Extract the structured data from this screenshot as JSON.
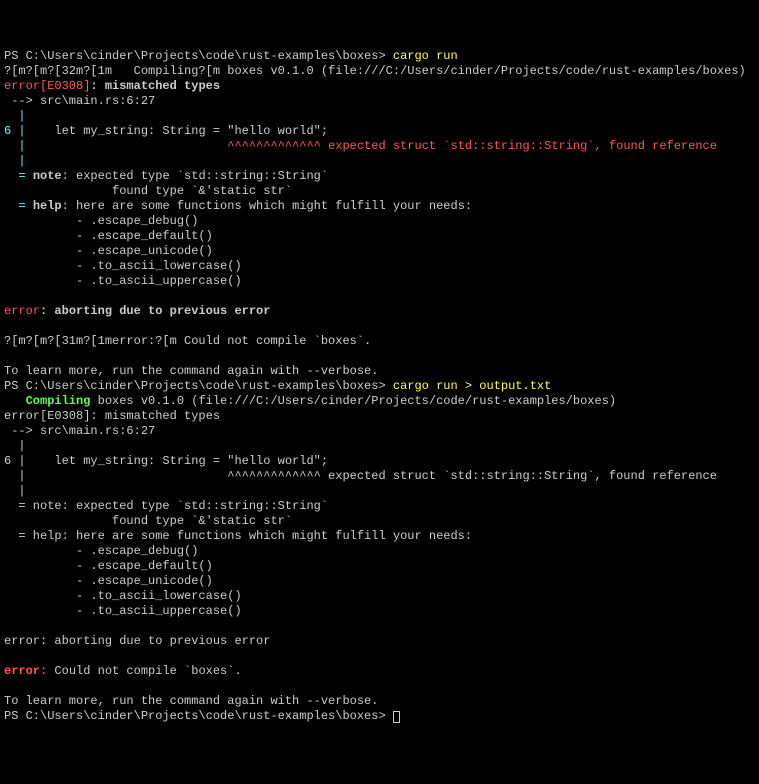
{
  "prompt1_path": "PS C:\\Users\\cinder\\Projects\\code\\rust-examples\\boxes> ",
  "prompt1_cmd": "cargo run",
  "run1_line1_a": "?[m?[m?[32m?[1m   Compiling?[m boxes v0.1.0 (file:///C:/Users/cinder/Projects/code/rust-examples/boxes)",
  "run1_err_a": "error[E0308]",
  "run1_err_b": ": mismatched types",
  "run1_loc": " --> src\\main.rs:6:27",
  "gutter_pipe_only": "  |",
  "gutter_6": "6",
  "gutter_6_pipe": " |",
  "code_line": "    let my_string: String = \"hello world\";",
  "caret_pad": "                            ",
  "caret": "^^^^^^^^^^^^^",
  "caret_msg": " expected struct `std::string::String`, found reference",
  "note_eq": "  = ",
  "note_label": "note",
  "note_text1": ": expected type `std::string::String`",
  "note_text2": "               found type `&'static str`",
  "help_label": "help",
  "help_text": ": here are some functions which might fulfill your needs:",
  "sug1": "          - .escape_debug()",
  "sug2": "          - .escape_default()",
  "sug3": "          - .escape_unicode()",
  "sug4": "          - .to_ascii_lowercase()",
  "sug5": "          - .to_ascii_uppercase()",
  "abort_err": "error",
  "abort_msg": ": aborting due to previous error",
  "run1_final_a": "?[m?[m?[31m?[1merror:?[m Could not compile `boxes`.",
  "learn_more": "To learn more, run the command again with --verbose.",
  "prompt2_path": "PS C:\\Users\\cinder\\Projects\\code\\rust-examples\\boxes> ",
  "prompt2_cmd": "cargo run > output.txt",
  "run2_compiling_a": "   Compiling",
  "run2_compiling_b": " boxes v0.1.0 (file:///C:/Users/cinder/Projects/code/rust-examples/boxes)",
  "run2_err": "error[E0308]: mismatched types",
  "run2_loc": " --> src\\main.rs:6:27",
  "run2_6": "6 |",
  "run2_caret_all": "                            ^^^^^^^^^^^^^ expected struct `std::string::String`, found reference",
  "run2_note1": "  = note: expected type `std::string::String`",
  "run2_note2": "               found type `&'static str`",
  "run2_help": "  = help: here are some functions which might fulfill your needs:",
  "run2_abort": "error: aborting due to previous error",
  "run2_final_a": "error:",
  "run2_final_b": " Could not compile `boxes`.",
  "prompt3_path": "PS C:\\Users\\cinder\\Projects\\code\\rust-examples\\boxes> "
}
